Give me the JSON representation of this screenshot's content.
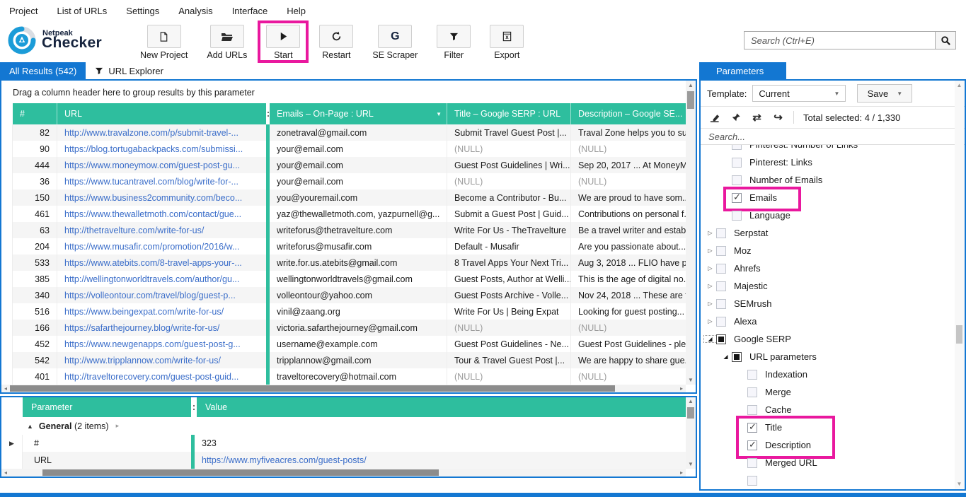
{
  "colors": {
    "teal": "#2EBE9E",
    "blue": "#1377D2",
    "magenta": "#E9189E",
    "link": "#3A6DC9"
  },
  "menu": {
    "items": [
      {
        "label": "Project"
      },
      {
        "label": "List of URLs"
      },
      {
        "label": "Settings"
      },
      {
        "label": "Analysis"
      },
      {
        "label": "Interface"
      },
      {
        "label": "Help"
      }
    ]
  },
  "toolbar": {
    "brand": {
      "top": "Netpeak",
      "bottom": "Checker"
    },
    "buttons": [
      {
        "label": "New Project",
        "icon": "new-document"
      },
      {
        "label": "Add URLs",
        "icon": "open-folder"
      },
      {
        "label": "Start",
        "icon": "play",
        "highlighted": true
      },
      {
        "label": "Restart",
        "icon": "refresh"
      },
      {
        "label": "SE Scraper",
        "icon": "google-g"
      },
      {
        "label": "Filter",
        "icon": "funnel"
      },
      {
        "label": "Export",
        "icon": "excel"
      }
    ],
    "se_scraper_glyph": "G",
    "search": {
      "placeholder": "Search (Ctrl+E)"
    }
  },
  "tabs": {
    "all_results": "All Results (542)",
    "url_explorer": "URL Explorer",
    "parameters": "Parameters"
  },
  "results": {
    "group_hint": "Drag a column header here to group results by this parameter",
    "columns": {
      "num": "#",
      "url": "URL",
      "emails": "Emails  –  On-Page  :  URL",
      "title": "Title  –  Google SERP  :  URL",
      "desc": "Description  –  Google SE..."
    },
    "rows": [
      {
        "num": "82",
        "url": "http://www.travalzone.com/p/submit-travel-...",
        "emails": "zonetraval@gmail.com",
        "title": "Submit Travel Guest Post |...",
        "desc": "Traval Zone helps you to su.."
      },
      {
        "num": "90",
        "url": "https://blog.tortugabackpacks.com/submissi...",
        "emails": "your@email.com",
        "title": "(NULL)",
        "desc": "(NULL)"
      },
      {
        "num": "444",
        "url": "https://www.moneymow.com/guest-post-gu...",
        "emails": "your@email.com",
        "title": "Guest Post Guidelines | Wri...",
        "desc": "Sep 20, 2017 ... At MoneyM."
      },
      {
        "num": "36",
        "url": "https://www.tucantravel.com/blog/write-for-...",
        "emails": "your@email.com",
        "title": "(NULL)",
        "desc": "(NULL)"
      },
      {
        "num": "150",
        "url": "https://www.business2community.com/beco...",
        "emails": "you@youremail.com",
        "title": "Become a Contributor - Bu...",
        "desc": "We are proud to have som.."
      },
      {
        "num": "461",
        "url": "https://www.thewalletmoth.com/contact/gue...",
        "emails": "yaz@thewalletmoth.com, yazpurnell@g...",
        "title": "Submit a Guest Post | Guid...",
        "desc": "Contributions on personal f."
      },
      {
        "num": "63",
        "url": "http://thetravelture.com/write-for-us/",
        "emails": "writeforus@thetravelture.com",
        "title": "Write For Us - TheTravelture",
        "desc": "Be a travel writer and estab."
      },
      {
        "num": "204",
        "url": "https://www.musafir.com/promotion/2016/w...",
        "emails": "writeforus@musafir.com",
        "title": "Default - Musafir",
        "desc": "Are you passionate about..."
      },
      {
        "num": "533",
        "url": "https://www.atebits.com/8-travel-apps-your-...",
        "emails": "write.for.us.atebits@gmail.com",
        "title": "8 Travel Apps Your Next Tri...",
        "desc": "Aug 3, 2018 ... FLIO have pa"
      },
      {
        "num": "385",
        "url": "http://wellingtonworldtravels.com/author/gu...",
        "emails": "wellingtonworldtravels@gmail.com",
        "title": "Guest Posts, Author at Welli...",
        "desc": "This is the age of digital no."
      },
      {
        "num": "340",
        "url": "https://volleontour.com/travel/blog/guest-p...",
        "emails": "volleontour@yahoo.com",
        "title": "Guest Posts Archive - Volle...",
        "desc": "Nov 24, 2018 ... These are t.."
      },
      {
        "num": "516",
        "url": "https://www.beingexpat.com/write-for-us/",
        "emails": "vinil@zaang.org",
        "title": "Write For Us | Being Expat",
        "desc": "Looking for guest posting..."
      },
      {
        "num": "166",
        "url": "https://safarthejourney.blog/write-for-us/",
        "emails": "victoria.safarthejourney@gmail.com",
        "title": "(NULL)",
        "desc": "(NULL)"
      },
      {
        "num": "452",
        "url": "https://www.newgenapps.com/guest-post-g...",
        "emails": "username@example.com",
        "title": "Guest Post Guidelines - Ne...",
        "desc": "Guest Post Guidelines - ple.."
      },
      {
        "num": "542",
        "url": "http://www.tripplannow.com/write-for-us/",
        "emails": "tripplannow@gmail.com",
        "title": "Tour & Travel Guest Post |...",
        "desc": "We are happy to share gue.."
      },
      {
        "num": "401",
        "url": "http://traveltorecovery.com/guest-post-guid...",
        "emails": "traveltorecovery@hotmail.com",
        "title": "(NULL)",
        "desc": "(NULL)"
      }
    ]
  },
  "details": {
    "columns": {
      "param": "Parameter",
      "value": "Value"
    },
    "group": {
      "label": "General",
      "count": "(2 items)"
    },
    "rows": [
      {
        "param": "#",
        "value": "323"
      },
      {
        "param": "URL",
        "value": "https://www.myfiveacres.com/guest-posts/"
      }
    ]
  },
  "params": {
    "tab": "Parameters",
    "template_label": "Template:",
    "template_value": "Current",
    "save_label": "Save",
    "total_selected": "Total selected: 4 / 1,330",
    "search_placeholder": "Search...",
    "tree": [
      {
        "cls": "lvl1 cbu clip",
        "label": "Pinterest: Number of Links"
      },
      {
        "cls": "lvl1 cbu",
        "label": "Pinterest: Links"
      },
      {
        "cls": "lvl1 cbu",
        "label": "Number of Emails"
      },
      {
        "cls": "lvl1 cbc hl1",
        "label": "Emails"
      },
      {
        "cls": "lvl1 cbu",
        "label": "Language"
      },
      {
        "cls": "lvl0 exc cbu",
        "label": "Serpstat"
      },
      {
        "cls": "lvl0 exc cbu",
        "label": "Moz"
      },
      {
        "cls": "lvl0 exc cbu",
        "label": "Ahrefs"
      },
      {
        "cls": "lvl0 exc cbu",
        "label": "Majestic"
      },
      {
        "cls": "lvl0 exc cbu",
        "label": "SEMrush"
      },
      {
        "cls": "lvl0 exc cbu",
        "label": "Alexa"
      },
      {
        "cls": "lvl0 exe cbi focus",
        "label": "Google SERP"
      },
      {
        "cls": "lvl1 exe cbi",
        "label": "URL parameters"
      },
      {
        "cls": "lvl2 cbu",
        "label": "Indexation"
      },
      {
        "cls": "lvl2 cbu",
        "label": "Merge"
      },
      {
        "cls": "lvl2 cbu",
        "label": "Cache"
      },
      {
        "cls": "lvl2 cbc hlt",
        "label": "Title"
      },
      {
        "cls": "lvl2 cbc hlb",
        "label": "Description"
      },
      {
        "cls": "lvl2 cbu",
        "label": "Merged URL"
      },
      {
        "cls": "lvl2 cbu",
        "label": ""
      }
    ]
  }
}
